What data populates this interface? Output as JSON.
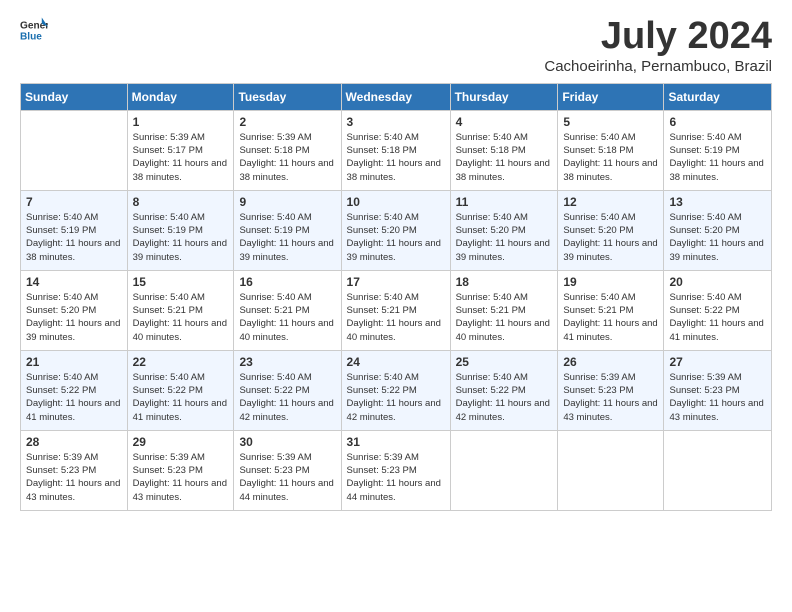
{
  "logo": {
    "general": "General",
    "blue": "Blue"
  },
  "header": {
    "month": "July 2024",
    "location": "Cachoeirinha, Pernambuco, Brazil"
  },
  "days_of_week": [
    "Sunday",
    "Monday",
    "Tuesday",
    "Wednesday",
    "Thursday",
    "Friday",
    "Saturday"
  ],
  "weeks": [
    [
      {
        "day": "",
        "sunrise": "",
        "sunset": "",
        "daylight": ""
      },
      {
        "day": "1",
        "sunrise": "Sunrise: 5:39 AM",
        "sunset": "Sunset: 5:17 PM",
        "daylight": "Daylight: 11 hours and 38 minutes."
      },
      {
        "day": "2",
        "sunrise": "Sunrise: 5:39 AM",
        "sunset": "Sunset: 5:18 PM",
        "daylight": "Daylight: 11 hours and 38 minutes."
      },
      {
        "day": "3",
        "sunrise": "Sunrise: 5:40 AM",
        "sunset": "Sunset: 5:18 PM",
        "daylight": "Daylight: 11 hours and 38 minutes."
      },
      {
        "day": "4",
        "sunrise": "Sunrise: 5:40 AM",
        "sunset": "Sunset: 5:18 PM",
        "daylight": "Daylight: 11 hours and 38 minutes."
      },
      {
        "day": "5",
        "sunrise": "Sunrise: 5:40 AM",
        "sunset": "Sunset: 5:18 PM",
        "daylight": "Daylight: 11 hours and 38 minutes."
      },
      {
        "day": "6",
        "sunrise": "Sunrise: 5:40 AM",
        "sunset": "Sunset: 5:19 PM",
        "daylight": "Daylight: 11 hours and 38 minutes."
      }
    ],
    [
      {
        "day": "7",
        "sunrise": "Sunrise: 5:40 AM",
        "sunset": "Sunset: 5:19 PM",
        "daylight": "Daylight: 11 hours and 38 minutes."
      },
      {
        "day": "8",
        "sunrise": "Sunrise: 5:40 AM",
        "sunset": "Sunset: 5:19 PM",
        "daylight": "Daylight: 11 hours and 39 minutes."
      },
      {
        "day": "9",
        "sunrise": "Sunrise: 5:40 AM",
        "sunset": "Sunset: 5:19 PM",
        "daylight": "Daylight: 11 hours and 39 minutes."
      },
      {
        "day": "10",
        "sunrise": "Sunrise: 5:40 AM",
        "sunset": "Sunset: 5:20 PM",
        "daylight": "Daylight: 11 hours and 39 minutes."
      },
      {
        "day": "11",
        "sunrise": "Sunrise: 5:40 AM",
        "sunset": "Sunset: 5:20 PM",
        "daylight": "Daylight: 11 hours and 39 minutes."
      },
      {
        "day": "12",
        "sunrise": "Sunrise: 5:40 AM",
        "sunset": "Sunset: 5:20 PM",
        "daylight": "Daylight: 11 hours and 39 minutes."
      },
      {
        "day": "13",
        "sunrise": "Sunrise: 5:40 AM",
        "sunset": "Sunset: 5:20 PM",
        "daylight": "Daylight: 11 hours and 39 minutes."
      }
    ],
    [
      {
        "day": "14",
        "sunrise": "Sunrise: 5:40 AM",
        "sunset": "Sunset: 5:20 PM",
        "daylight": "Daylight: 11 hours and 39 minutes."
      },
      {
        "day": "15",
        "sunrise": "Sunrise: 5:40 AM",
        "sunset": "Sunset: 5:21 PM",
        "daylight": "Daylight: 11 hours and 40 minutes."
      },
      {
        "day": "16",
        "sunrise": "Sunrise: 5:40 AM",
        "sunset": "Sunset: 5:21 PM",
        "daylight": "Daylight: 11 hours and 40 minutes."
      },
      {
        "day": "17",
        "sunrise": "Sunrise: 5:40 AM",
        "sunset": "Sunset: 5:21 PM",
        "daylight": "Daylight: 11 hours and 40 minutes."
      },
      {
        "day": "18",
        "sunrise": "Sunrise: 5:40 AM",
        "sunset": "Sunset: 5:21 PM",
        "daylight": "Daylight: 11 hours and 40 minutes."
      },
      {
        "day": "19",
        "sunrise": "Sunrise: 5:40 AM",
        "sunset": "Sunset: 5:21 PM",
        "daylight": "Daylight: 11 hours and 41 minutes."
      },
      {
        "day": "20",
        "sunrise": "Sunrise: 5:40 AM",
        "sunset": "Sunset: 5:22 PM",
        "daylight": "Daylight: 11 hours and 41 minutes."
      }
    ],
    [
      {
        "day": "21",
        "sunrise": "Sunrise: 5:40 AM",
        "sunset": "Sunset: 5:22 PM",
        "daylight": "Daylight: 11 hours and 41 minutes."
      },
      {
        "day": "22",
        "sunrise": "Sunrise: 5:40 AM",
        "sunset": "Sunset: 5:22 PM",
        "daylight": "Daylight: 11 hours and 41 minutes."
      },
      {
        "day": "23",
        "sunrise": "Sunrise: 5:40 AM",
        "sunset": "Sunset: 5:22 PM",
        "daylight": "Daylight: 11 hours and 42 minutes."
      },
      {
        "day": "24",
        "sunrise": "Sunrise: 5:40 AM",
        "sunset": "Sunset: 5:22 PM",
        "daylight": "Daylight: 11 hours and 42 minutes."
      },
      {
        "day": "25",
        "sunrise": "Sunrise: 5:40 AM",
        "sunset": "Sunset: 5:22 PM",
        "daylight": "Daylight: 11 hours and 42 minutes."
      },
      {
        "day": "26",
        "sunrise": "Sunrise: 5:39 AM",
        "sunset": "Sunset: 5:23 PM",
        "daylight": "Daylight: 11 hours and 43 minutes."
      },
      {
        "day": "27",
        "sunrise": "Sunrise: 5:39 AM",
        "sunset": "Sunset: 5:23 PM",
        "daylight": "Daylight: 11 hours and 43 minutes."
      }
    ],
    [
      {
        "day": "28",
        "sunrise": "Sunrise: 5:39 AM",
        "sunset": "Sunset: 5:23 PM",
        "daylight": "Daylight: 11 hours and 43 minutes."
      },
      {
        "day": "29",
        "sunrise": "Sunrise: 5:39 AM",
        "sunset": "Sunset: 5:23 PM",
        "daylight": "Daylight: 11 hours and 43 minutes."
      },
      {
        "day": "30",
        "sunrise": "Sunrise: 5:39 AM",
        "sunset": "Sunset: 5:23 PM",
        "daylight": "Daylight: 11 hours and 44 minutes."
      },
      {
        "day": "31",
        "sunrise": "Sunrise: 5:39 AM",
        "sunset": "Sunset: 5:23 PM",
        "daylight": "Daylight: 11 hours and 44 minutes."
      },
      {
        "day": "",
        "sunrise": "",
        "sunset": "",
        "daylight": ""
      },
      {
        "day": "",
        "sunrise": "",
        "sunset": "",
        "daylight": ""
      },
      {
        "day": "",
        "sunrise": "",
        "sunset": "",
        "daylight": ""
      }
    ]
  ]
}
